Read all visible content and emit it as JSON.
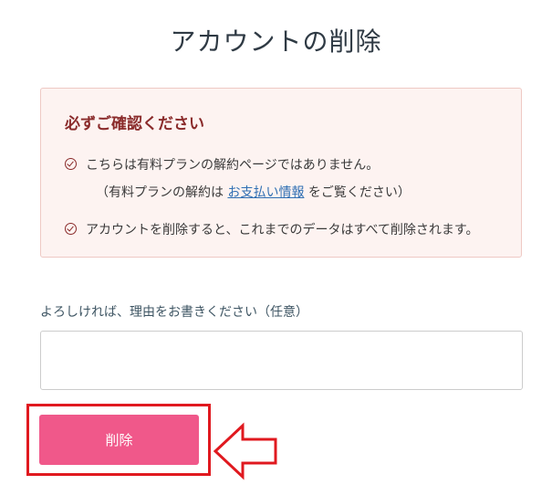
{
  "page": {
    "title": "アカウントの削除"
  },
  "notice": {
    "title": "必ずご確認ください",
    "item1_text": "こちらは有料プランの解約ページではありません。",
    "item1_sub_prefix": "（有料プランの解約は ",
    "item1_sub_link": "お支払い情報",
    "item1_sub_suffix": " をご覧ください）",
    "item2_text": "アカウントを削除すると、これまでのデータはすべて削除されます。"
  },
  "reason": {
    "label": "よろしければ、理由をお書きください（任意）",
    "value": ""
  },
  "actions": {
    "delete_label": "削除"
  },
  "colors": {
    "notice_accent": "#8a2b2b",
    "button": "#f0588a",
    "highlight": "#e0191f",
    "link": "#2f6fb3"
  },
  "icons": {
    "check": "check-circle-icon",
    "arrow": "left-arrow-icon"
  }
}
